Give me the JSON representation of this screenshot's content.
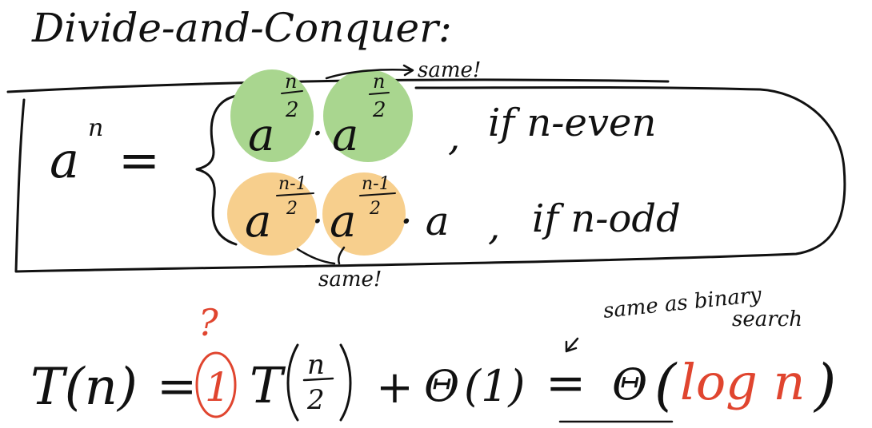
{
  "heading": "Divide-and-Conquer:",
  "equation": {
    "lhs": "a",
    "lhs_exp": "n",
    "equals": "=",
    "even_case": {
      "base": "a",
      "exp_num": "n",
      "exp_den": "2",
      "dot": "·",
      "comma": ",",
      "condition": "if n-even"
    },
    "odd_case": {
      "base": "a",
      "exp_num": "n-1",
      "exp_den": "2",
      "dot": "·",
      "times_a": "· a",
      "comma": ",",
      "condition": "if n-odd"
    }
  },
  "annotations": {
    "same_top": "same!",
    "same_bottom": "same!",
    "same_as_binary": "same as binary",
    "search": "search",
    "question": "?"
  },
  "recurrence": {
    "T_n": "T(n)",
    "equals": "=",
    "coefficient": "1",
    "T": "T",
    "frac_num": "n",
    "frac_den": "2",
    "plus": "+",
    "theta": "Θ",
    "one": "(1)",
    "equals2": "=",
    "result_theta": "Θ",
    "result_inner": "log n",
    "open_paren": "(",
    "close_paren": ")"
  },
  "colors": {
    "ink": "#111111",
    "green_highlight": "#a9d68f",
    "orange_highlight": "#f7cf8d",
    "red_ink": "#e0452f"
  }
}
